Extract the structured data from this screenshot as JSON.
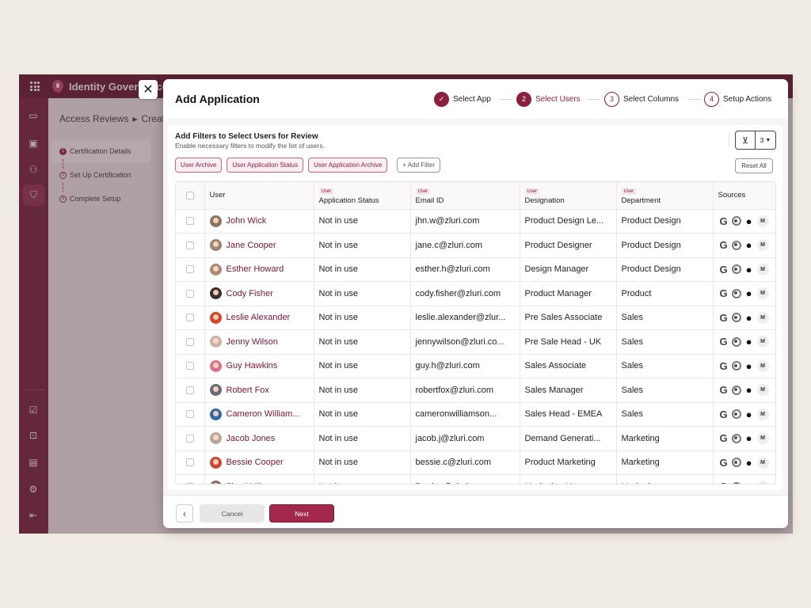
{
  "app": {
    "title": "Identity Governance"
  },
  "breadcrumb": {
    "root": "Access Reviews",
    "current": "Create"
  },
  "side_steps": [
    {
      "num": "1",
      "label": "Certification Details"
    },
    {
      "num": "2",
      "label": "Set Up Certification"
    },
    {
      "num": "3",
      "label": "Complete Setup"
    }
  ],
  "modal": {
    "title": "Add Application",
    "steps": [
      {
        "num": "✓",
        "label": "Select App",
        "state": "done"
      },
      {
        "num": "2",
        "label": "Select Users",
        "state": "current"
      },
      {
        "num": "3",
        "label": "Select Columns",
        "state": "todo"
      },
      {
        "num": "4",
        "label": "Setup Actions",
        "state": "todo"
      }
    ],
    "filters": {
      "title": "Add Filters to Select Users for Review",
      "subtitle": "Enable necessary filters to modify the list of users.",
      "filter_count": "3",
      "chips": [
        "User Archive",
        "User Application Status",
        "User Application Archive"
      ],
      "add_filter": "+ Add Filter",
      "reset_all": "Reset All"
    },
    "table": {
      "columns": [
        {
          "tag": "",
          "label": "User"
        },
        {
          "tag": "User",
          "label": "Application Status"
        },
        {
          "tag": "User",
          "label": "Email ID"
        },
        {
          "tag": "User",
          "label": "Designation"
        },
        {
          "tag": "User",
          "label": "Department"
        },
        {
          "tag": "",
          "label": "Sources"
        }
      ],
      "rows": [
        {
          "name": "John Wick",
          "status": "Not in use",
          "email": "jhn.w@zluri.com",
          "designation": "Product Design Le...",
          "department": "Product Design",
          "avatar_color": "#8a7560"
        },
        {
          "name": "Jane Cooper",
          "status": "Not in use",
          "email": "jane.c@zluri.com",
          "designation": "Product Designer",
          "department": "Product Design",
          "avatar_color": "#9b8470"
        },
        {
          "name": "Esther Howard",
          "status": "Not in use",
          "email": "esther.h@zluri.com",
          "designation": "Design Manager",
          "department": "Product Design",
          "avatar_color": "#a88a75"
        },
        {
          "name": "Cody Fisher",
          "status": "Not in use",
          "email": "cody.fisher@zluri.com",
          "designation": "Product Manager",
          "department": "Product",
          "avatar_color": "#3b2d2a"
        },
        {
          "name": "Leslie Alexander",
          "status": "Not in use",
          "email": "leslie.alexander@zlur...",
          "designation": "Pre Sales Associate",
          "department": "Sales",
          "avatar_color": "#d4462a"
        },
        {
          "name": "Jenny Wilson",
          "status": "Not in use",
          "email": "jennywilson@zluri.co...",
          "designation": "Pre Sale Head - UK",
          "department": "Sales",
          "avatar_color": "#c9b3a8"
        },
        {
          "name": "Guy Hawkins",
          "status": "Not in use",
          "email": "guy.h@zluri.com",
          "designation": "Sales Associate",
          "department": "Sales",
          "avatar_color": "#d9728a"
        },
        {
          "name": "Robert Fox",
          "status": "Not in use",
          "email": "robertfox@zluri.com",
          "designation": "Sales Manager",
          "department": "Sales",
          "avatar_color": "#6a6a75"
        },
        {
          "name": "Cameron William...",
          "status": "Not in use",
          "email": "cameronwilliamson...",
          "designation": "Sales Head - EMEA",
          "department": "Sales",
          "avatar_color": "#2f6aa0"
        },
        {
          "name": "Jacob Jones",
          "status": "Not in use",
          "email": "jacob.j@zluri.com",
          "designation": "Demand Generati...",
          "department": "Marketing",
          "avatar_color": "#b8a89a"
        },
        {
          "name": "Bessie Cooper",
          "status": "Not in use",
          "email": "bessie.c@zluri.com",
          "designation": "Product Marketing",
          "department": "Marketing",
          "avatar_color": "#c44a3a"
        },
        {
          "name": "Floyd Miles",
          "status": "Not in use",
          "email": "floyd.m@zluri.com",
          "designation": "Marketing Manager",
          "department": "Marketing",
          "avatar_color": "#8b6f5f"
        }
      ],
      "source_icons": [
        "google-icon",
        "chrome-icon",
        "apple-icon",
        "m-icon"
      ],
      "source_m_label": "M"
    },
    "footer": {
      "back": "‹",
      "cancel": "Cancel",
      "next": "Next"
    }
  },
  "colors": {
    "brand_dark": "#5a0e26",
    "brand": "#8b1f3f",
    "next_button": "#a3294c"
  }
}
